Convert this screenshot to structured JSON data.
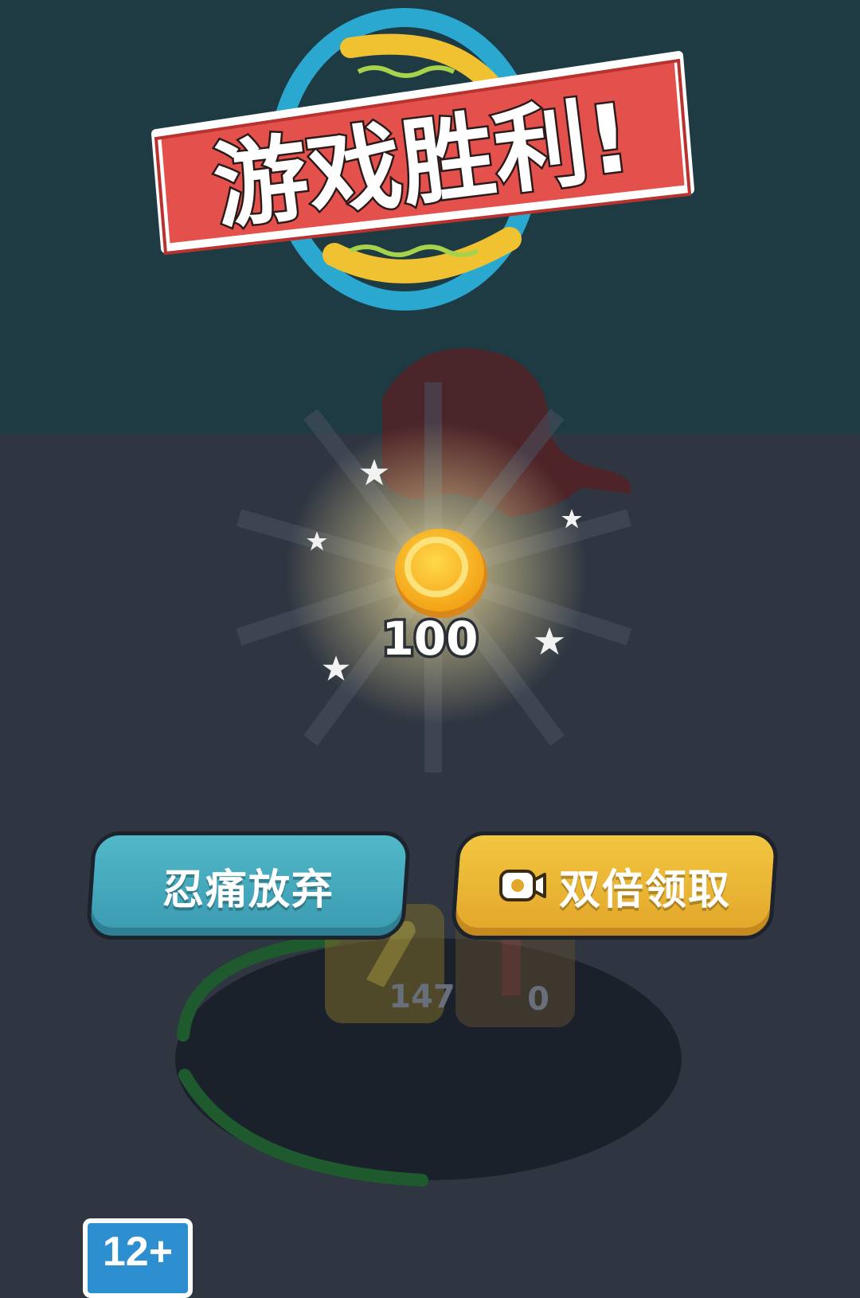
{
  "banner": {
    "title": "游戏胜利!"
  },
  "reward": {
    "coin_amount": "100"
  },
  "buttons": {
    "give_up": "忍痛放弃",
    "double_claim": "双倍领取"
  },
  "inventory": {
    "ammo_count": "147",
    "item_count": "0"
  },
  "age_rating": "12+",
  "colors": {
    "sky": "#1e3a43",
    "ground": "#2f3641",
    "banner_red": "#e4514c",
    "give_up_button": "#47a9bd",
    "double_button": "#ecb835",
    "coin": "#f6b21f"
  }
}
